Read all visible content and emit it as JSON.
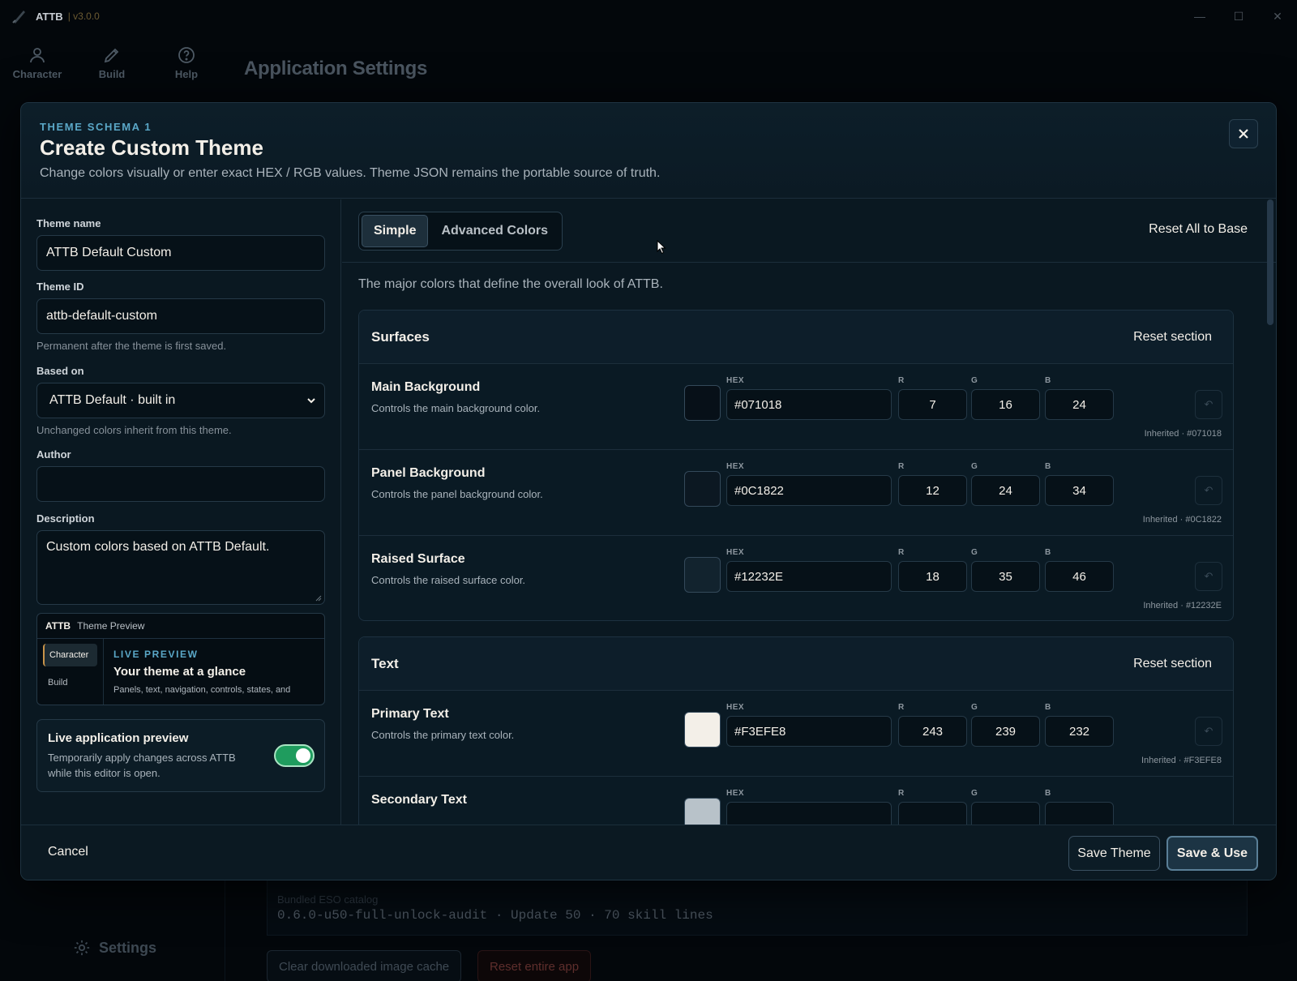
{
  "titlebar": {
    "app_name": "ATTB",
    "version": "| v3.0.0",
    "icon": "app-logo-icon"
  },
  "window_controls": {
    "minimize": "—",
    "maximize": "☐",
    "close": "✕"
  },
  "nav": [
    {
      "label": "Character",
      "icon": "person-icon"
    },
    {
      "label": "Build",
      "icon": "pencil-icon"
    },
    {
      "label": "Help",
      "icon": "help-icon"
    }
  ],
  "page_title": "Application Settings",
  "background": {
    "settings_label": "Settings",
    "catalog_label": "Bundled ESO catalog",
    "catalog_value": "0.6.0-u50-full-unlock-audit · Update 50 · 70 skill lines",
    "clear_cache_label": "Clear downloaded image cache",
    "reset_app_label": "Reset entire app"
  },
  "modal": {
    "eyebrow": "THEME SCHEMA 1",
    "title": "Create Custom Theme",
    "subtitle": "Change colors visually or enter exact HEX / RGB values. Theme JSON remains the portable source of truth.",
    "form": {
      "theme_name_label": "Theme name",
      "theme_name_value": "ATTB Default Custom",
      "theme_id_label": "Theme ID",
      "theme_id_value": "attb-default-custom",
      "theme_id_hint": "Permanent after the theme is first saved.",
      "based_on_label": "Based on",
      "based_on_value": "ATTB Default · built in",
      "based_on_hint": "Unchanged colors inherit from this theme.",
      "author_label": "Author",
      "author_value": "",
      "description_label": "Description",
      "description_value": "Custom colors based on ATTB Default."
    },
    "preview": {
      "brand": "ATTB",
      "header": "Theme Preview",
      "nav_items": [
        "Character",
        "Build"
      ],
      "eyebrow": "LIVE PREVIEW",
      "title": "Your theme at a glance",
      "desc": "Panels, text, navigation, controls, states, and"
    },
    "live_preview": {
      "title": "Live application preview",
      "desc": "Temporarily apply changes across ATTB while this editor is open.",
      "enabled": true
    },
    "tabs": {
      "simple": "Simple",
      "advanced": "Advanced Colors",
      "active": "Simple"
    },
    "reset_all": "Reset All to Base",
    "intro": "The major colors that define the overall look of ATTB.",
    "labels": {
      "hex": "HEX",
      "r": "R",
      "g": "G",
      "b": "B",
      "undo": "↶"
    },
    "sections": [
      {
        "title": "Surfaces",
        "reset": "Reset section",
        "rows": [
          {
            "title": "Main Background",
            "desc": "Controls the main background color.",
            "hex": "#071018",
            "r": "7",
            "g": "16",
            "b": "24",
            "inherited": "Inherited · #071018"
          },
          {
            "title": "Panel Background",
            "desc": "Controls the panel background color.",
            "hex": "#0C1822",
            "r": "12",
            "g": "24",
            "b": "34",
            "inherited": "Inherited · #0C1822"
          },
          {
            "title": "Raised Surface",
            "desc": "Controls the raised surface color.",
            "hex": "#12232E",
            "r": "18",
            "g": "35",
            "b": "46",
            "inherited": "Inherited · #12232E"
          }
        ]
      },
      {
        "title": "Text",
        "reset": "Reset section",
        "rows": [
          {
            "title": "Primary Text",
            "desc": "Controls the primary text color.",
            "hex": "#F3EFE8",
            "r": "243",
            "g": "239",
            "b": "232",
            "inherited": "Inherited · #F3EFE8"
          },
          {
            "title": "Secondary Text",
            "swatch": "#b8c2c9"
          }
        ]
      }
    ],
    "footer": {
      "cancel": "Cancel",
      "save": "Save Theme",
      "save_use": "Save & Use"
    }
  }
}
